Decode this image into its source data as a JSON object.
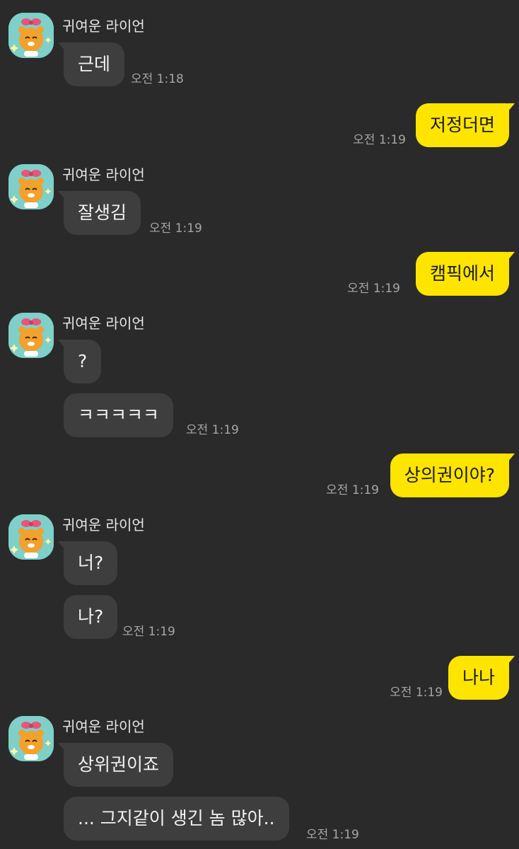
{
  "sender_name": "귀여운 라이언",
  "messages": {
    "m1": "근데",
    "m2": "저정더면",
    "m3": "잘생김",
    "m4": "캠픽에서",
    "m5": "?",
    "m6": "ㅋㅋㅋㅋㅋ",
    "m7": "상의권이야?",
    "m8": "너?",
    "m9": "나?",
    "m10": "나나",
    "m11": "상위권이죠",
    "m12": "... 그지같이 생긴 놈 많아.."
  },
  "times": {
    "t1": "오전 1:18",
    "t2": "오전 1:19",
    "t3": "오전 1:19",
    "t4": "오전 1:19",
    "t5": "오전 1:19",
    "t6": "오전 1:19",
    "t7": "오전 1:19",
    "t8": "오전 1:19",
    "t9": "오전 1:19"
  },
  "colors": {
    "background": "#2a2a2a",
    "incoming_bubble": "#3e3e3e",
    "outgoing_bubble": "#fee500",
    "avatar_bg": "#7ed0c8"
  },
  "icons": {
    "avatar": "ryan-with-bow-avatar-icon"
  }
}
